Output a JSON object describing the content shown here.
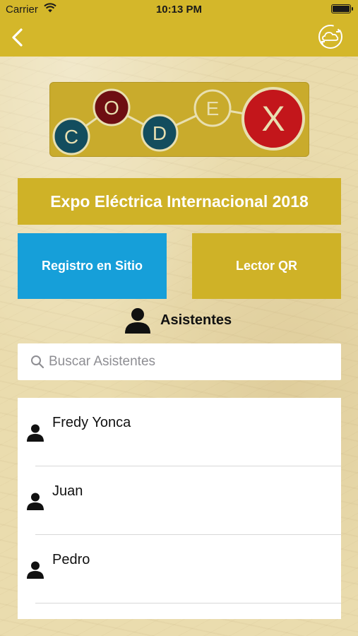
{
  "status_bar": {
    "carrier": "Carrier",
    "time": "10:13 PM"
  },
  "nav": {
    "back_icon": "chevron-left-icon",
    "sync_icon": "cloud-sync-icon"
  },
  "logo": {
    "letters": [
      "C",
      "O",
      "D",
      "E",
      "X"
    ]
  },
  "event": {
    "title": "Expo Eléctrica Internacional 2018"
  },
  "actions": {
    "registro_label": "Registro en Sitio",
    "lector_label": "Lector QR"
  },
  "attendees": {
    "header": "Asistentes",
    "search_placeholder": "Buscar Asistentes",
    "items": [
      {
        "name": "Fredy Yonca"
      },
      {
        "name": "Juan"
      },
      {
        "name": "Pedro"
      }
    ]
  },
  "colors": {
    "brand_gold": "#d4b72a",
    "accent_blue": "#169fd9",
    "logo_red": "#c3161b",
    "logo_teal": "#134d5e",
    "logo_maroon": "#6e0e12"
  }
}
